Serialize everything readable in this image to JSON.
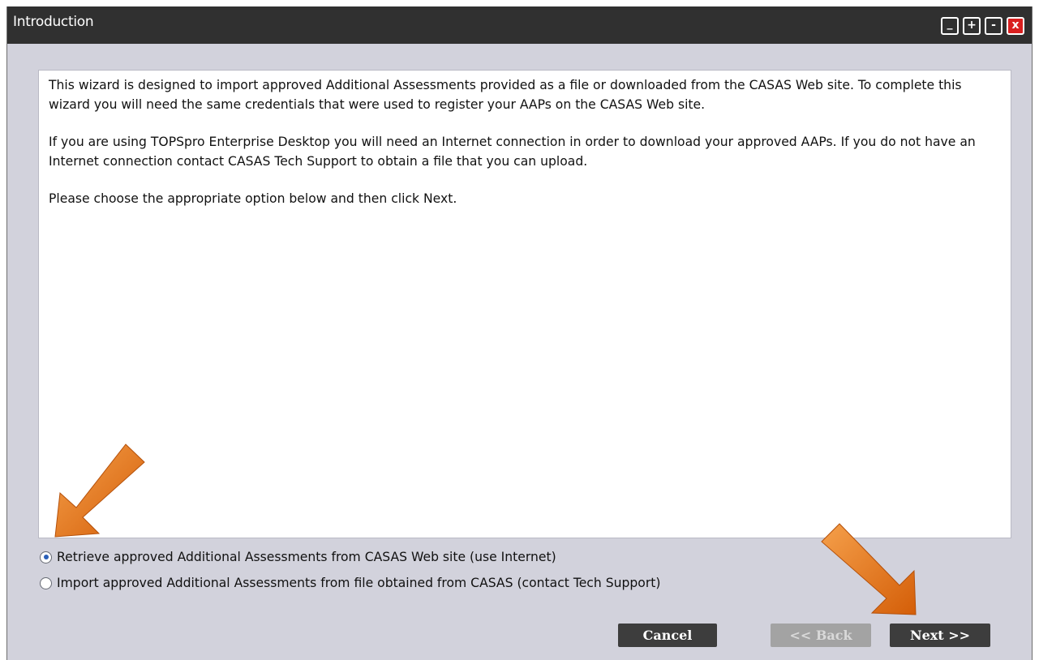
{
  "window": {
    "title": "Introduction",
    "controls": [
      {
        "name": "minimize-icon",
        "glyph": "_"
      },
      {
        "name": "expand-icon",
        "glyph": "+"
      },
      {
        "name": "collapse-icon",
        "glyph": "-"
      },
      {
        "name": "close-icon",
        "glyph": "x"
      }
    ]
  },
  "intro": {
    "paragraph1": "This wizard is designed to import approved Additional Assessments provided as a file or downloaded from the CASAS Web site. To complete this wizard you will need the same credentials that were used to register your AAPs on the CASAS Web site.",
    "paragraph2": "If you are using TOPSpro Enterprise Desktop you will need an Internet connection in order to download your approved AAPs. If you do not have an Internet connection contact CASAS Tech Support to obtain a file that you can upload.",
    "paragraph3": "Please choose the appropriate option below and then click Next."
  },
  "options": {
    "retrieve_label": "Retrieve approved Additional Assessments from CASAS Web site (use Internet)",
    "retrieve_selected": true,
    "import_label": "Import approved Additional Assessments from file obtained from CASAS (contact Tech Support)",
    "import_selected": false
  },
  "buttons": {
    "cancel": "Cancel",
    "back": "<< Back",
    "back_enabled": false,
    "next": "Next >>"
  },
  "colors": {
    "titlebar": "#303030",
    "window_bg": "#d2d2dc",
    "close_button": "#d91f1f",
    "button_dark": "#3d3d3d",
    "button_disabled": "#a3a3a3",
    "arrow_orange": "#e8731a"
  }
}
